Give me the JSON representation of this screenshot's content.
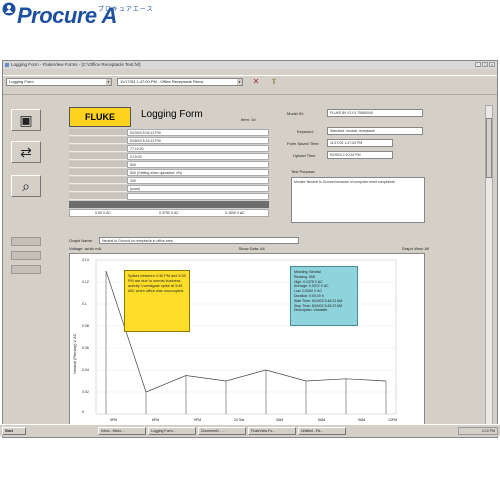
{
  "brand": {
    "name": "Procure A",
    "kana": "プロキュアエース",
    "color": "#1e50a0"
  },
  "window": {
    "title": "Logging Form - FlukeView Forms - [C:\\Office Receptacle Test.fvf]"
  },
  "toolbar": {
    "form_select": "Logging Form",
    "record_select": "11/17/03 1:47:00 PM - Office Receptacle Recor"
  },
  "form": {
    "logo": "FLUKE",
    "title": "Logging Form",
    "item_label": "Item: 1d",
    "model_label": "Model ID:",
    "model_value": "FLUKE 89 V1.01 75560040",
    "keyword_label": "Keyword:",
    "keyword_value": "Standard, neutral, receptacle",
    "form_saved_label": "Form Saved Time",
    "form_saved_value": "11/17/04 1:47:00 PM",
    "upload_label": "Upload Time",
    "upload_value": "5/29/03 2:10:26 PM",
    "purpose_label": "Test Purpose:",
    "purpose_text": "Monitor Neutral to Ground because of computer reset complaints",
    "grid_values": [
      "5/23/03 5:03:13 PM",
      "5/28/03 8:15:13 PM",
      "77:10:00",
      "0:15:00",
      "500",
      "500  (Getting when uploaded: 4%)",
      "300",
      "(none)"
    ],
    "grid_bottom_values": [
      "0.00 V AC",
      "0.3792 V AC",
      "0.1500 V AC"
    ]
  },
  "graph": {
    "name_label": "Graph Name:",
    "name_value": "Neutral to Ground on receptacle in office area",
    "info_left": "Voltage: ac/dc mA",
    "info_mid": "Show Data: All",
    "info_right": "Graph View: All",
    "ylabel": "Neutral (Primary) V AC",
    "yticks": [
      "0.14",
      "0.12",
      "0.1",
      "0.08",
      "0.06",
      "0.04",
      "0.02",
      "0"
    ],
    "xticks": [
      "3PM",
      "6PM",
      "9PM",
      "24 Sat",
      "3AM",
      "6AM",
      "9AM",
      "12PM"
    ],
    "note_yellow": "Spikes between 2:30 PM and 5:00 PM are due to normal business activity. Investigate spike at 3:45 AM, when office was unoccupied.",
    "note_cyan": [
      "Meaning: Neutral",
      "Reading: 508",
      "High: 0.1375 V AC",
      "Average: 0.0072 V AC",
      "Low: 0.0000 V AC",
      "Duration: 0:00:00 h",
      "Start Time: 5/24/03 3:45:22 AM",
      "Stop Time: 5/24/03 3:45:22 AM",
      "Description: Unstable"
    ]
  },
  "taskbar": {
    "start": "Start",
    "tasks": [
      "Inbox - Micro...",
      "Logging Form...",
      "Document1 - ...",
      "FlukeView Fo...",
      "Untitled - Pa..."
    ],
    "clock": "2:10 PM"
  },
  "chart_data": {
    "type": "line",
    "ylabel": "Neutral (Primary) V AC",
    "ylim": [
      0,
      0.14
    ],
    "x": [
      "3PM",
      "6PM",
      "9PM",
      "24 Sat",
      "3AM",
      "6AM",
      "9AM",
      "12PM"
    ],
    "series": [
      {
        "values": [
          0.13,
          0.02,
          0.035,
          0.03,
          0.04,
          0.03,
          0.032,
          0.03
        ]
      }
    ],
    "grid": true
  }
}
